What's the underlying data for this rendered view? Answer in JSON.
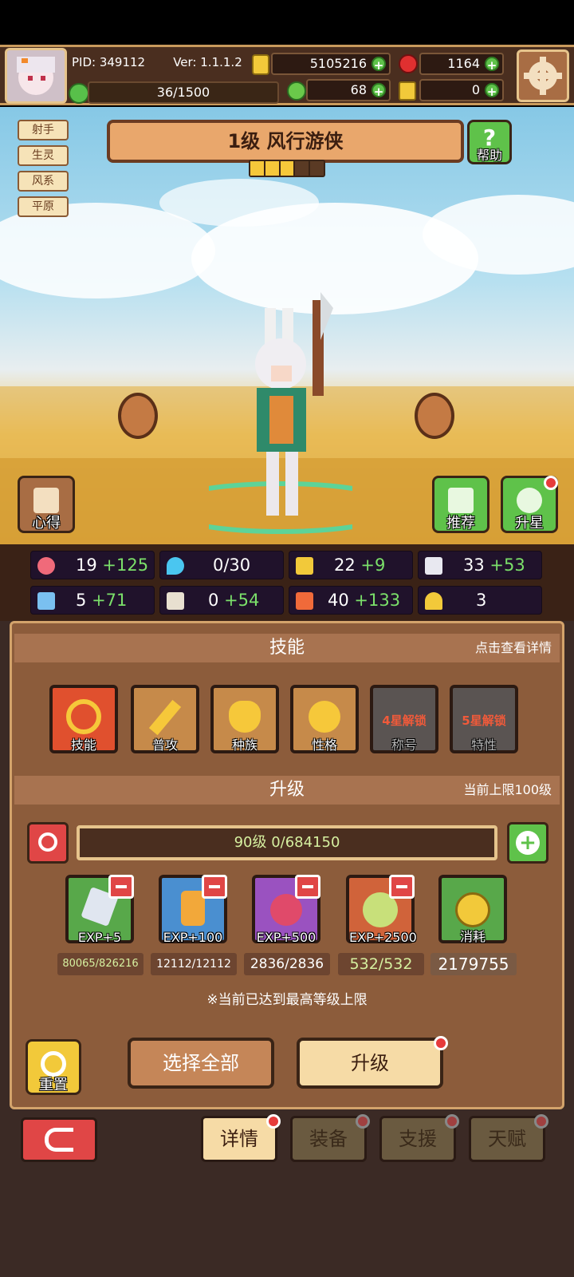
{
  "header": {
    "pid": "PID: 349112",
    "version": "Ver: 1.1.1.2",
    "gold": "5105216",
    "gems": "1164",
    "stamina": "36/1500",
    "clover": "68",
    "key": "0"
  },
  "tags": [
    "射手",
    "生灵",
    "风系",
    "平原"
  ],
  "hero": {
    "title": "1级  风行游侠",
    "stars_filled": 3,
    "stars_total": 5
  },
  "buttons": {
    "help": "帮助",
    "insight": "心得",
    "recommend": "推荐",
    "star_up": "升星"
  },
  "stats": [
    {
      "base": "19",
      "bonus": "+125",
      "icon": "heart-icon"
    },
    {
      "base": "0/30",
      "bonus": "",
      "icon": "water-drop-icon"
    },
    {
      "base": "22",
      "bonus": "+9",
      "icon": "shield-icon"
    },
    {
      "base": "33",
      "bonus": "+53",
      "icon": "wing-icon"
    },
    {
      "base": "5",
      "bonus": "+71",
      "icon": "portrait-icon"
    },
    {
      "base": "0",
      "bonus": "+54",
      "icon": "book-icon"
    },
    {
      "base": "40",
      "bonus": "+133",
      "icon": "boot-icon"
    },
    {
      "base": "3",
      "bonus": "",
      "icon": "horseshoe-icon"
    }
  ],
  "skills_section": {
    "title": "技能",
    "hint": "点击查看详情",
    "items": [
      {
        "label": "技能",
        "lock": "",
        "icon": "bow-icon"
      },
      {
        "label": "普攻",
        "lock": "",
        "icon": "sword-icon"
      },
      {
        "label": "种族",
        "lock": "",
        "icon": "rabbit-icon"
      },
      {
        "label": "性格",
        "lock": "",
        "icon": "figure-icon"
      },
      {
        "label": "称号",
        "lock": "4星解锁",
        "icon": "locked-icon"
      },
      {
        "label": "特性",
        "lock": "5星解锁",
        "icon": "locked-icon"
      }
    ]
  },
  "upgrade_section": {
    "title": "升级",
    "hint": "当前上限100级",
    "progress": "90级  0/684150",
    "items": [
      {
        "label": "EXP+5",
        "count": "80065/826216",
        "icon": "crystal-icon",
        "color": "#58a84a"
      },
      {
        "label": "EXP+100",
        "count": "12112/12112",
        "icon": "potion-icon",
        "color": "#4a8fd0"
      },
      {
        "label": "EXP+500",
        "count": "2836/2836",
        "icon": "berry-icon",
        "color": "#9a52c0"
      },
      {
        "label": "EXP+2500",
        "count": "532/532",
        "icon": "cabbage-icon",
        "color": "#d0633a"
      },
      {
        "label": "消耗",
        "count": "2179755",
        "icon": "coin-icon",
        "color": "#58a84a"
      }
    ],
    "max_note": "※当前已达到最高等级上限"
  },
  "actions": {
    "reset": "重置",
    "select_all": "选择全部",
    "upgrade": "升级"
  },
  "tabs": [
    "详情",
    "装备",
    "支援",
    "天赋"
  ]
}
